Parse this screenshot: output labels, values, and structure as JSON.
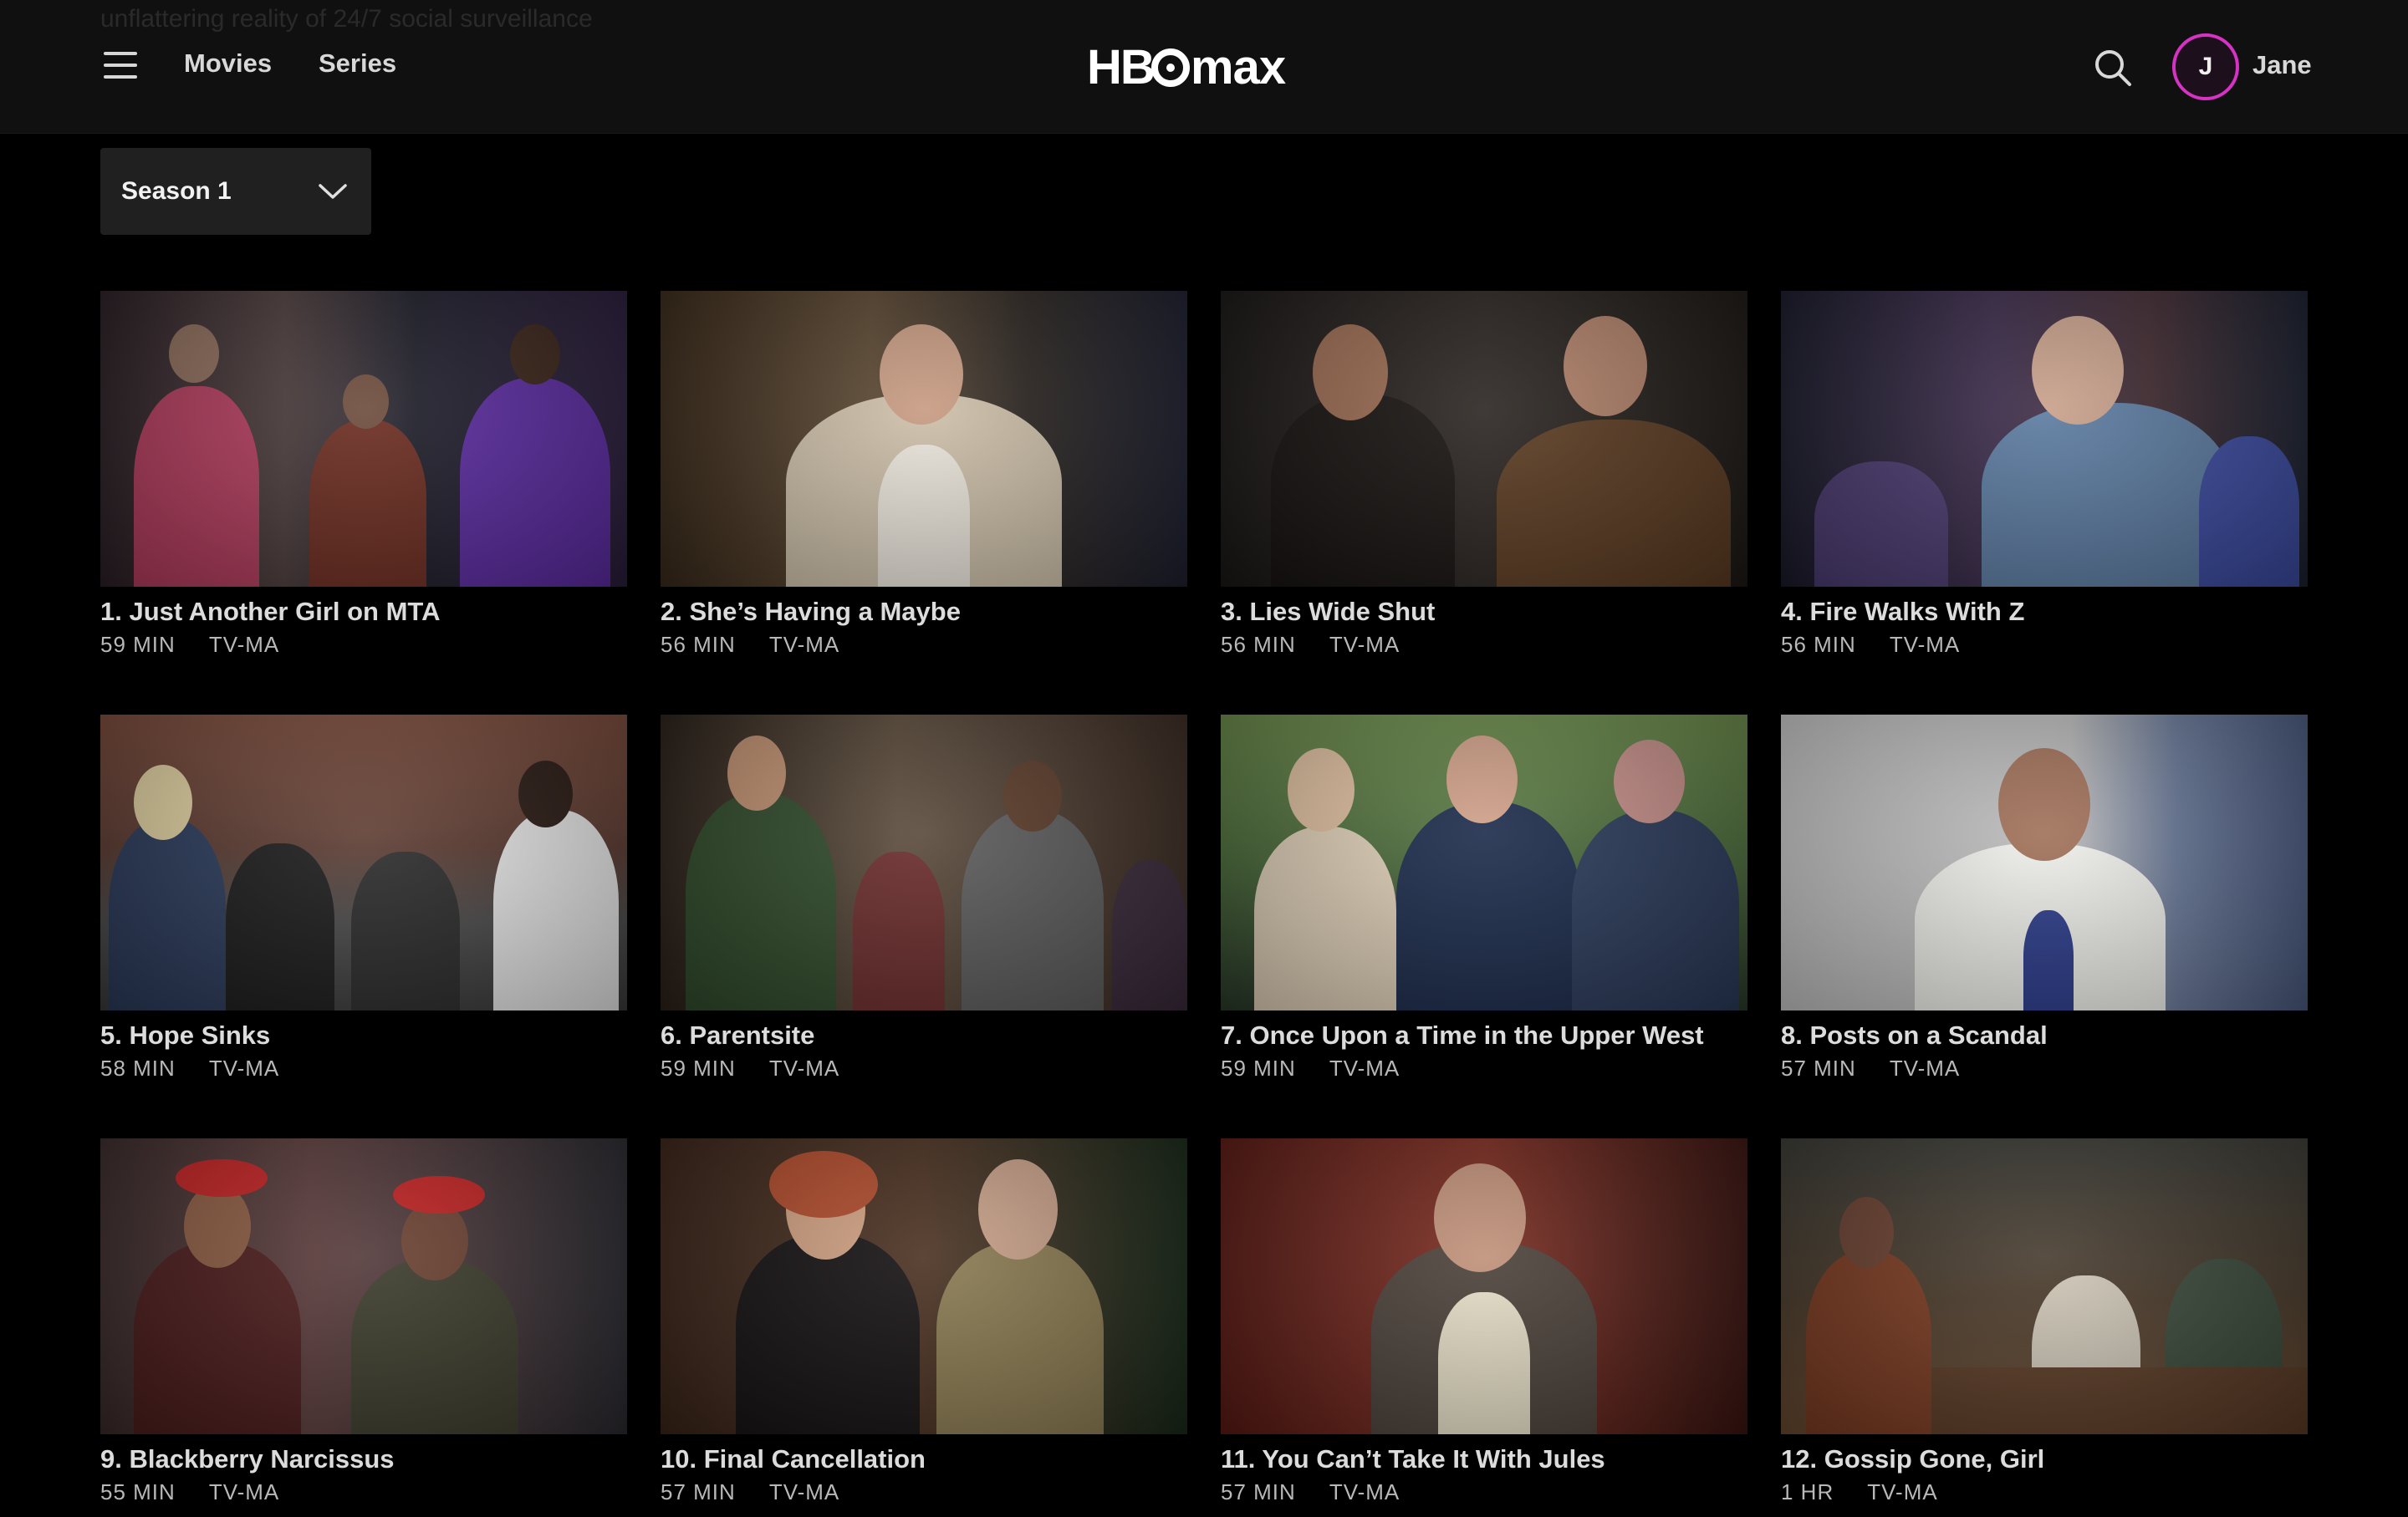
{
  "header": {
    "ghost_line_1": "unflattering reality of 24/7 social surveillance",
    "ghost_line_2": "",
    "nav": [
      {
        "label": "Movies"
      },
      {
        "label": "Series"
      }
    ],
    "logo_text": "HBOmax",
    "user": {
      "initial": "J",
      "name": "Jane"
    }
  },
  "season_select": {
    "value": "Season 1"
  },
  "episodes": [
    {
      "title": "1. Just Another Girl on MTA",
      "duration": "59 MIN",
      "rating": "TV-MA"
    },
    {
      "title": "2. She’s Having a Maybe",
      "duration": "56 MIN",
      "rating": "TV-MA"
    },
    {
      "title": "3. Lies Wide Shut",
      "duration": "56 MIN",
      "rating": "TV-MA"
    },
    {
      "title": "4. Fire Walks With Z",
      "duration": "56 MIN",
      "rating": "TV-MA"
    },
    {
      "title": "5. Hope Sinks",
      "duration": "58 MIN",
      "rating": "TV-MA"
    },
    {
      "title": "6. Parentsite",
      "duration": "59 MIN",
      "rating": "TV-MA"
    },
    {
      "title": "7. Once Upon a Time in the Upper West",
      "duration": "59 MIN",
      "rating": "TV-MA"
    },
    {
      "title": "8. Posts on a Scandal",
      "duration": "57 MIN",
      "rating": "TV-MA"
    },
    {
      "title": "9. Blackberry Narcissus",
      "duration": "55 MIN",
      "rating": "TV-MA"
    },
    {
      "title": "10. Final Cancellation",
      "duration": "57 MIN",
      "rating": "TV-MA"
    },
    {
      "title": "11. You Can’t Take It With Jules",
      "duration": "57 MIN",
      "rating": "TV-MA"
    },
    {
      "title": "12. Gossip Gone, Girl",
      "duration": "1 HR",
      "rating": "TV-MA"
    }
  ],
  "colors": {
    "background": "#000000",
    "header_bg": "#101010",
    "avatar_ring": "#d632c4"
  }
}
